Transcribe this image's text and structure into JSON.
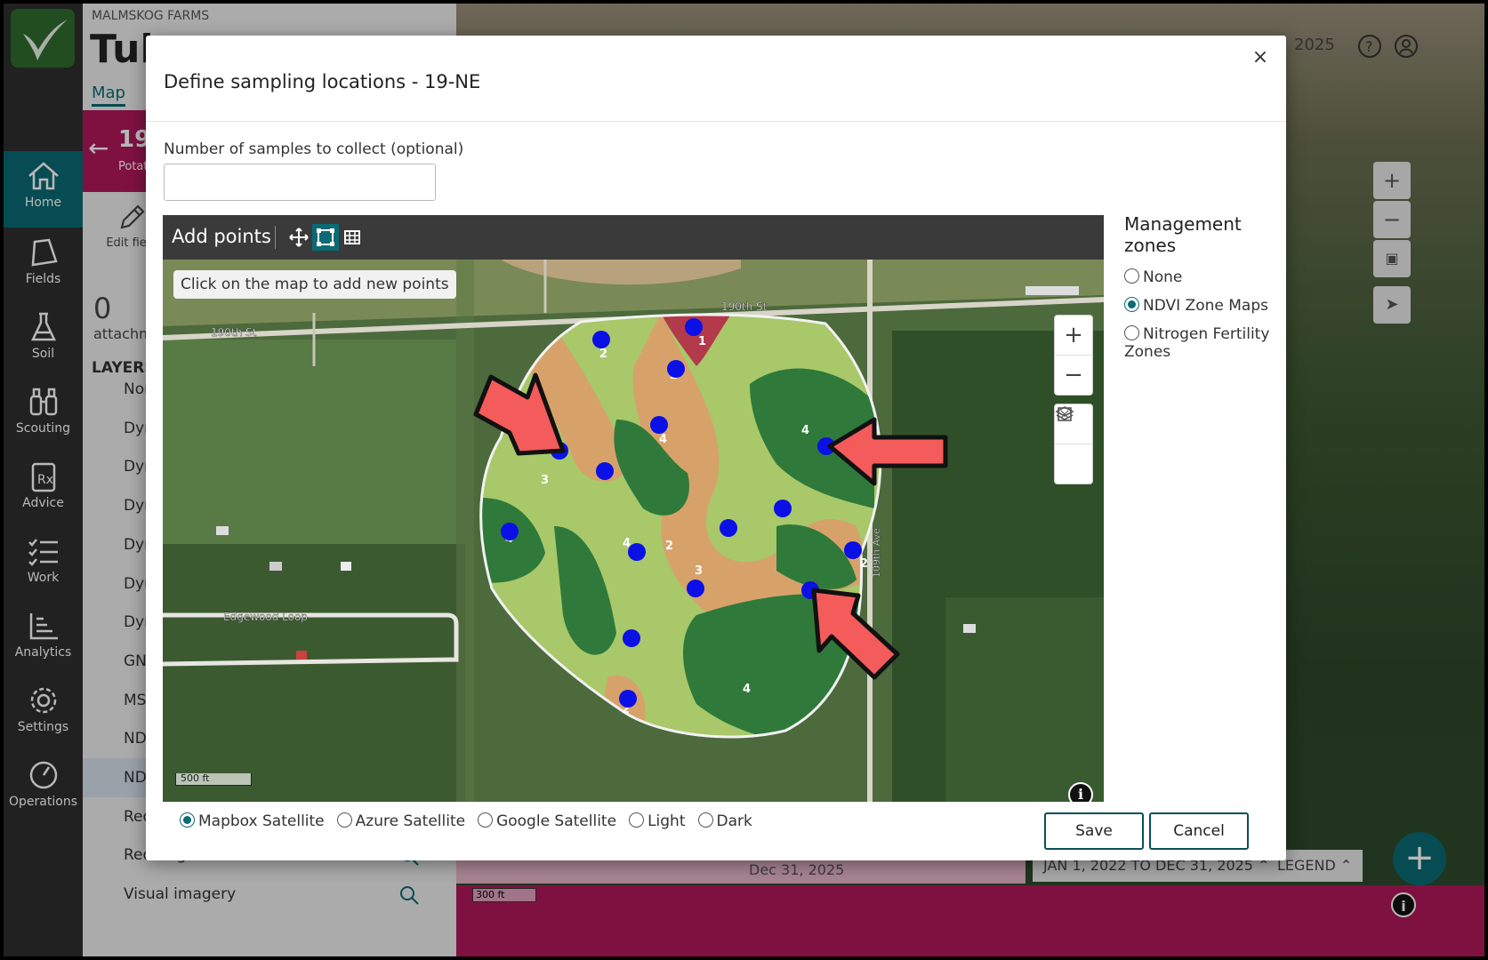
{
  "app": {
    "farm_name": "MALMSKOG FARMS",
    "page_title_partial": "Tub",
    "tab_map": "Map",
    "year": "2025"
  },
  "nav": {
    "items": [
      {
        "label": "Home",
        "icon": "home-icon",
        "active": true
      },
      {
        "label": "Fields",
        "icon": "field-icon"
      },
      {
        "label": "Soil",
        "icon": "flask-icon"
      },
      {
        "label": "Scouting",
        "icon": "binoculars-icon"
      },
      {
        "label": "Advice",
        "icon": "prescription-icon"
      },
      {
        "label": "Work",
        "icon": "checklist-icon"
      },
      {
        "label": "Analytics",
        "icon": "chart-icon"
      },
      {
        "label": "Settings",
        "icon": "gear-icon"
      },
      {
        "label": "Operations",
        "icon": "gauge-icon"
      }
    ]
  },
  "field_panel": {
    "field_code_partial": "19-",
    "crop_partial": "Potat",
    "edit_label_partial": "Edit field",
    "attachments_count": "0",
    "attachments_label_partial": "attachm",
    "layers_title": "LAYERS",
    "layers": [
      "Nor",
      "Dyn",
      "Dyn",
      "Dyn",
      "Dyn",
      "Dyn",
      "Dyn",
      "GNI",
      "MSA",
      "NDR",
      "NDV",
      "Red",
      "Red-edge band",
      "Visual imagery"
    ]
  },
  "bg_map": {
    "timeline_label": "Dec 31, 2025",
    "scale": "300 ft",
    "date_range": "JAN 1, 2022 TO DEC 31, 2025",
    "legend": "LEGEND"
  },
  "modal": {
    "title": "Define sampling locations - 19-NE",
    "close_label": "×",
    "samples_label": "Number of samples to collect (optional)",
    "samples_value": "",
    "samples_placeholder": "",
    "toolbar": {
      "add_points_label": "Add points",
      "tools": [
        {
          "name": "move-icon",
          "active": false
        },
        {
          "name": "draw-points-icon",
          "active": true
        },
        {
          "name": "grid-icon",
          "active": false
        }
      ]
    },
    "map": {
      "hint": "Click on the map to add new points",
      "scale": "500 ft",
      "info": "i",
      "road_labels": [
        "190th St",
        "190th St",
        "Edgewood Loop",
        "109th Ave"
      ],
      "zone_labels": [
        "1",
        "2",
        "2",
        "2",
        "2",
        "2",
        "3",
        "3",
        "4",
        "4",
        "4",
        "4",
        "4"
      ],
      "sample_point_count": 16
    },
    "basemaps": [
      {
        "label": "Mapbox Satellite",
        "selected": true
      },
      {
        "label": "Azure Satellite",
        "selected": false
      },
      {
        "label": "Google Satellite",
        "selected": false
      },
      {
        "label": "Light",
        "selected": false
      },
      {
        "label": "Dark",
        "selected": false
      }
    ],
    "zones": {
      "title": "Management zones",
      "options": [
        {
          "label": "None",
          "selected": false
        },
        {
          "label": "NDVI Zone Maps",
          "selected": true
        },
        {
          "label": "Nitrogen Fertility Zones",
          "selected": false
        }
      ]
    },
    "save_label": "Save",
    "cancel_label": "Cancel"
  },
  "colors": {
    "teal": "#0b6a74",
    "magenta": "#b0185a",
    "point_blue": "#0a10e6",
    "zone_dark_green": "#2f7a3a",
    "zone_light_green": "#a8c86a",
    "zone_tan": "#d7a26a",
    "zone_red": "#b23a4a",
    "arrow_red": "#f45b5b"
  }
}
